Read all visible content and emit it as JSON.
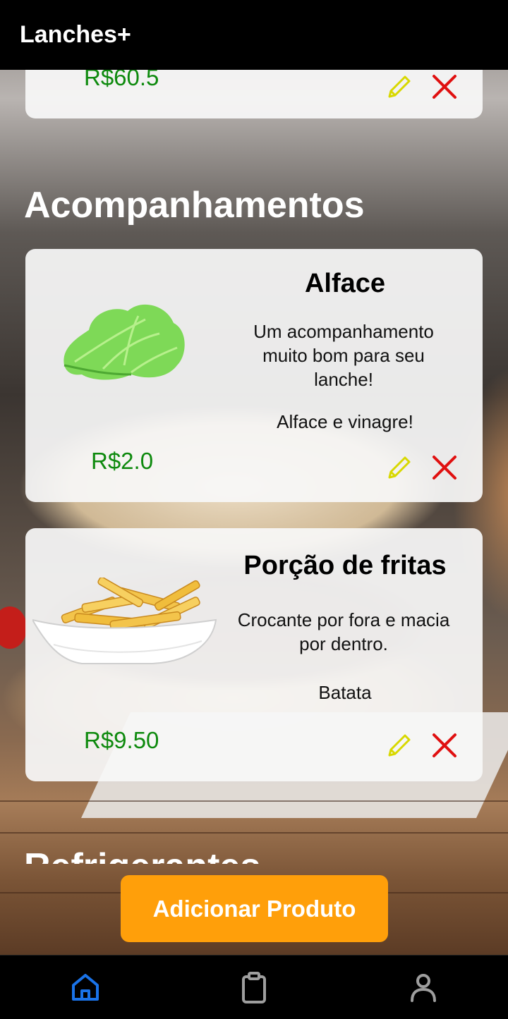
{
  "app": {
    "title": "Lanches+"
  },
  "top_card": {
    "price": "R$60.5"
  },
  "section": {
    "title": "Acompanhamentos"
  },
  "next_section": {
    "title": "Refrigerantes"
  },
  "products": [
    {
      "name": "Alface",
      "description": "Um acompanhamento muito bom para seu lanche!",
      "ingredients": "Alface e vinagre!",
      "price": "R$2.0"
    },
    {
      "name": "Porção de fritas",
      "description": "Crocante por fora e macia por dentro.",
      "ingredients": "Batata",
      "price": "R$9.50"
    }
  ],
  "actions": {
    "add_product": "Adicionar Produto"
  },
  "icons": {
    "edit": "pencil-icon",
    "delete": "close-icon"
  },
  "nav": [
    {
      "name": "home",
      "icon": "home-icon",
      "active": true
    },
    {
      "name": "orders",
      "icon": "clipboard-icon",
      "active": false
    },
    {
      "name": "profile",
      "icon": "user-icon",
      "active": false
    }
  ],
  "colors": {
    "price": "#0e8a0e",
    "edit": "#d8d800",
    "delete": "#e01010",
    "primary_button": "#ff9f0a",
    "nav_active": "#1a73e8",
    "nav_inactive": "#9e9e9e"
  }
}
